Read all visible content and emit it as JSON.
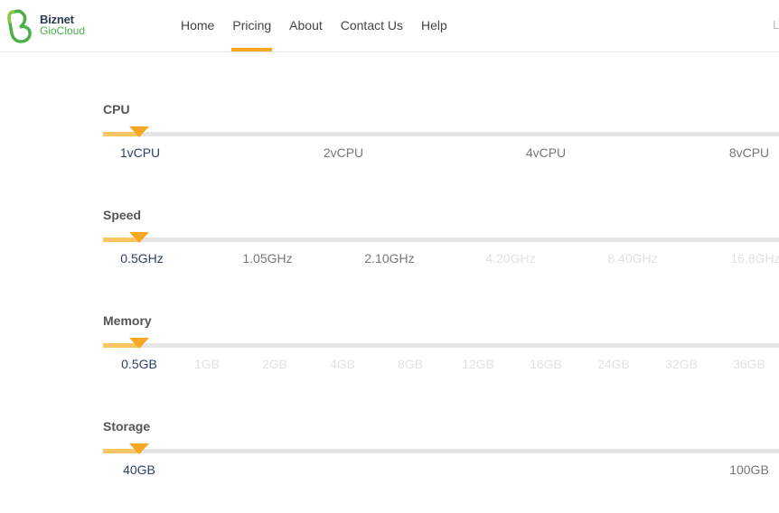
{
  "brand": {
    "name": "Biznet",
    "product": "GioCloud"
  },
  "nav": [
    {
      "label": "Home",
      "active": false
    },
    {
      "label": "Pricing",
      "active": true
    },
    {
      "label": "About",
      "active": false
    },
    {
      "label": "Contact Us",
      "active": false
    },
    {
      "label": "Help",
      "active": false
    }
  ],
  "header_right_text": "L",
  "colors": {
    "accent": "#f7a823",
    "accent_light": "#f9c563",
    "track": "#e5e5e5",
    "selected_text": "#2e3f6e",
    "disabled_text": "#e2e2e2"
  },
  "sliders": [
    {
      "title": "CPU",
      "selected_index": 0,
      "options": [
        {
          "label": "1vCPU",
          "state": "selected"
        },
        {
          "label": "2vCPU",
          "state": "enabled"
        },
        {
          "label": "4vCPU",
          "state": "enabled"
        },
        {
          "label": "8vCPU",
          "state": "enabled"
        }
      ]
    },
    {
      "title": "Speed",
      "selected_index": 0,
      "options": [
        {
          "label": "0.5GHz",
          "state": "selected"
        },
        {
          "label": "1.05GHz",
          "state": "enabled"
        },
        {
          "label": "2.10GHz",
          "state": "enabled"
        },
        {
          "label": "4.20GHz",
          "state": "disabled"
        },
        {
          "label": "8.40GHz",
          "state": "disabled"
        },
        {
          "label": "16.8GHz",
          "state": "disabled"
        }
      ]
    },
    {
      "title": "Memory",
      "selected_index": 0,
      "options": [
        {
          "label": "0.5GB",
          "state": "selected"
        },
        {
          "label": "1GB",
          "state": "disabled"
        },
        {
          "label": "2GB",
          "state": "disabled"
        },
        {
          "label": "4GB",
          "state": "disabled"
        },
        {
          "label": "8GB",
          "state": "disabled"
        },
        {
          "label": "12GB",
          "state": "disabled"
        },
        {
          "label": "16GB",
          "state": "disabled"
        },
        {
          "label": "24GB",
          "state": "disabled"
        },
        {
          "label": "32GB",
          "state": "disabled"
        },
        {
          "label": "36GB",
          "state": "disabled"
        }
      ]
    },
    {
      "title": "Storage",
      "selected_index": 0,
      "options": [
        {
          "label": "40GB",
          "state": "selected"
        },
        {
          "label": "100GB",
          "state": "enabled"
        }
      ]
    }
  ]
}
